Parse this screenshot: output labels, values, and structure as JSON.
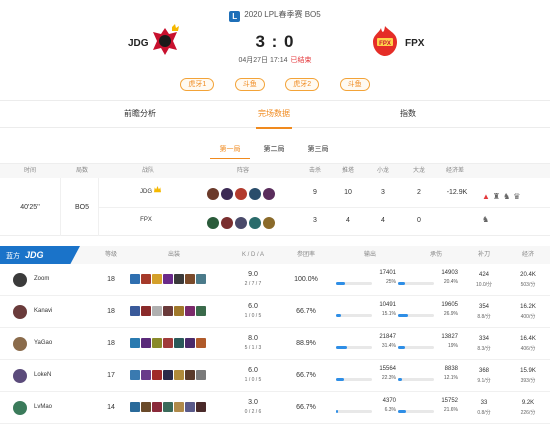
{
  "header": {
    "league_badge": "L",
    "league": "2020 LPL春季赛 BO5",
    "team_left": "JDG",
    "team_right": "FPX",
    "score": "3 : 0",
    "date": "04月27日 17:14",
    "status": "已结束",
    "streams": [
      "虎牙1",
      "斗鱼",
      "虎牙2",
      "斗鱼"
    ]
  },
  "tabs": [
    "前瞻分析",
    "完场数据",
    "指数"
  ],
  "active_tab": "完场数据",
  "game_tabs": [
    "第一局",
    "第二局",
    "第三局"
  ],
  "active_game_tab": "第一局",
  "game_summary": {
    "headers": [
      "时间",
      "局数",
      "战队",
      "阵容",
      "击杀",
      "推塔",
      "小龙",
      "大龙",
      "经济差"
    ],
    "duration": "40'25''",
    "format": "BO5",
    "rows": [
      {
        "team": "JDG",
        "kills": "9",
        "towers": "10",
        "dragons": "3",
        "barons": "2",
        "gold_diff": "-12.9K"
      },
      {
        "team": "FPX",
        "kills": "3",
        "towers": "4",
        "dragons": "4",
        "barons": "0",
        "gold_diff": ""
      }
    ]
  },
  "player_table": {
    "side_label": "蓝方",
    "team": "JDG",
    "headers": [
      "等级",
      "出装",
      "K / D / A",
      "参团率",
      "输出",
      "承伤",
      "补刀",
      "经济"
    ],
    "players": [
      {
        "name": "Zoom",
        "level": "18",
        "kda": "9.0",
        "kda_detail": "2 / 7 / 7",
        "kp": "100.0%",
        "dmg": "17401",
        "dmg_pct": "25%",
        "dmg_frac": 0.25,
        "taken": "14903",
        "taken_pct": "20.4%",
        "taken_frac": 0.204,
        "cs": "424",
        "cs_rate": "10.0/分",
        "gold": "20.4K",
        "gold_rate": "503/分"
      },
      {
        "name": "Kanavi",
        "level": "18",
        "kda": "6.0",
        "kda_detail": "1 / 0 / 5",
        "kp": "66.7%",
        "dmg": "10491",
        "dmg_pct": "15.1%",
        "dmg_frac": 0.151,
        "taken": "19605",
        "taken_pct": "26.9%",
        "taken_frac": 0.269,
        "cs": "354",
        "cs_rate": "8.8/分",
        "gold": "16.2K",
        "gold_rate": "400/分"
      },
      {
        "name": "YaGao",
        "level": "18",
        "kda": "8.0",
        "kda_detail": "5 / 1 / 3",
        "kp": "88.9%",
        "dmg": "21847",
        "dmg_pct": "31.4%",
        "dmg_frac": 0.314,
        "taken": "13827",
        "taken_pct": "19%",
        "taken_frac": 0.19,
        "cs": "334",
        "cs_rate": "8.3/分",
        "gold": "16.4K",
        "gold_rate": "406/分"
      },
      {
        "name": "LokeN",
        "level": "17",
        "kda": "6.0",
        "kda_detail": "1 / 0 / 5",
        "kp": "66.7%",
        "dmg": "15564",
        "dmg_pct": "22.3%",
        "dmg_frac": 0.223,
        "taken": "8838",
        "taken_pct": "12.1%",
        "taken_frac": 0.121,
        "cs": "368",
        "cs_rate": "9.1/分",
        "gold": "15.9K",
        "gold_rate": "393/分"
      },
      {
        "name": "LvMao",
        "level": "14",
        "kda": "3.0",
        "kda_detail": "0 / 2 / 6",
        "kp": "66.7%",
        "dmg": "4370",
        "dmg_pct": "6.3%",
        "dmg_frac": 0.063,
        "taken": "15752",
        "taken_pct": "21.6%",
        "taken_frac": 0.216,
        "cs": "33",
        "cs_rate": "0.8/分",
        "gold": "9.2K",
        "gold_rate": "226/分"
      }
    ]
  },
  "colors": {
    "accent": "#f08a1e",
    "blue": "#2e8ee6",
    "side_blue": "#1a73c9",
    "jdg_red": "#c8102e",
    "fpx_red": "#e52d27"
  }
}
